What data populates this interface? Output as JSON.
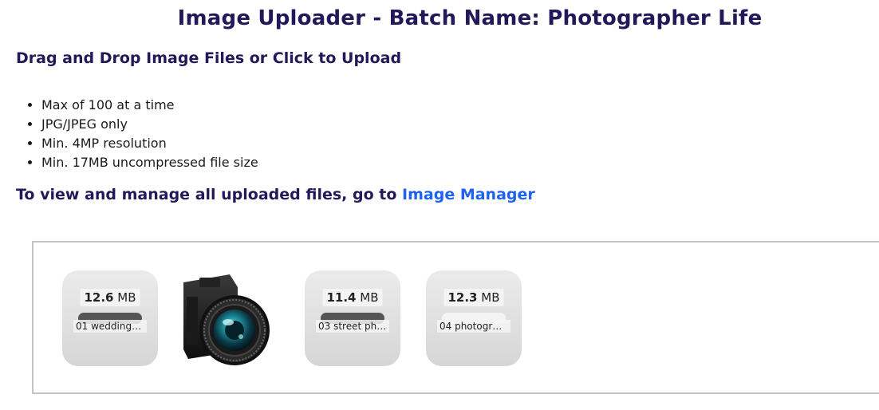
{
  "page": {
    "title": "Image Uploader - Batch Name: Photographer Life",
    "subtitle": "Drag and Drop Image Files or Click to Upload",
    "rules": [
      "Max of 100 at a time",
      "JPG/JPEG only",
      "Min. 4MP resolution",
      "Min. 17MB uncompressed file size"
    ],
    "manager_text": "To view and manage all uploaded files, go to",
    "manager_link": "Image Manager"
  },
  "uploads": [
    {
      "size_value": "12.6",
      "size_unit": "MB",
      "name": "01 wedding…",
      "progress": 1.0
    },
    {
      "type": "image-preview",
      "icon": "camera-photo-icon"
    },
    {
      "size_value": "11.4",
      "size_unit": "MB",
      "name": "03 street ph…",
      "progress": 1.0
    },
    {
      "size_value": "12.3",
      "size_unit": "MB",
      "name": "04 photogr…",
      "progress": 0.0
    }
  ],
  "colors": {
    "heading": "#23195a",
    "link": "#1d63f0",
    "card_bg": "#e0e0e0",
    "progress_fill": "#555555"
  }
}
